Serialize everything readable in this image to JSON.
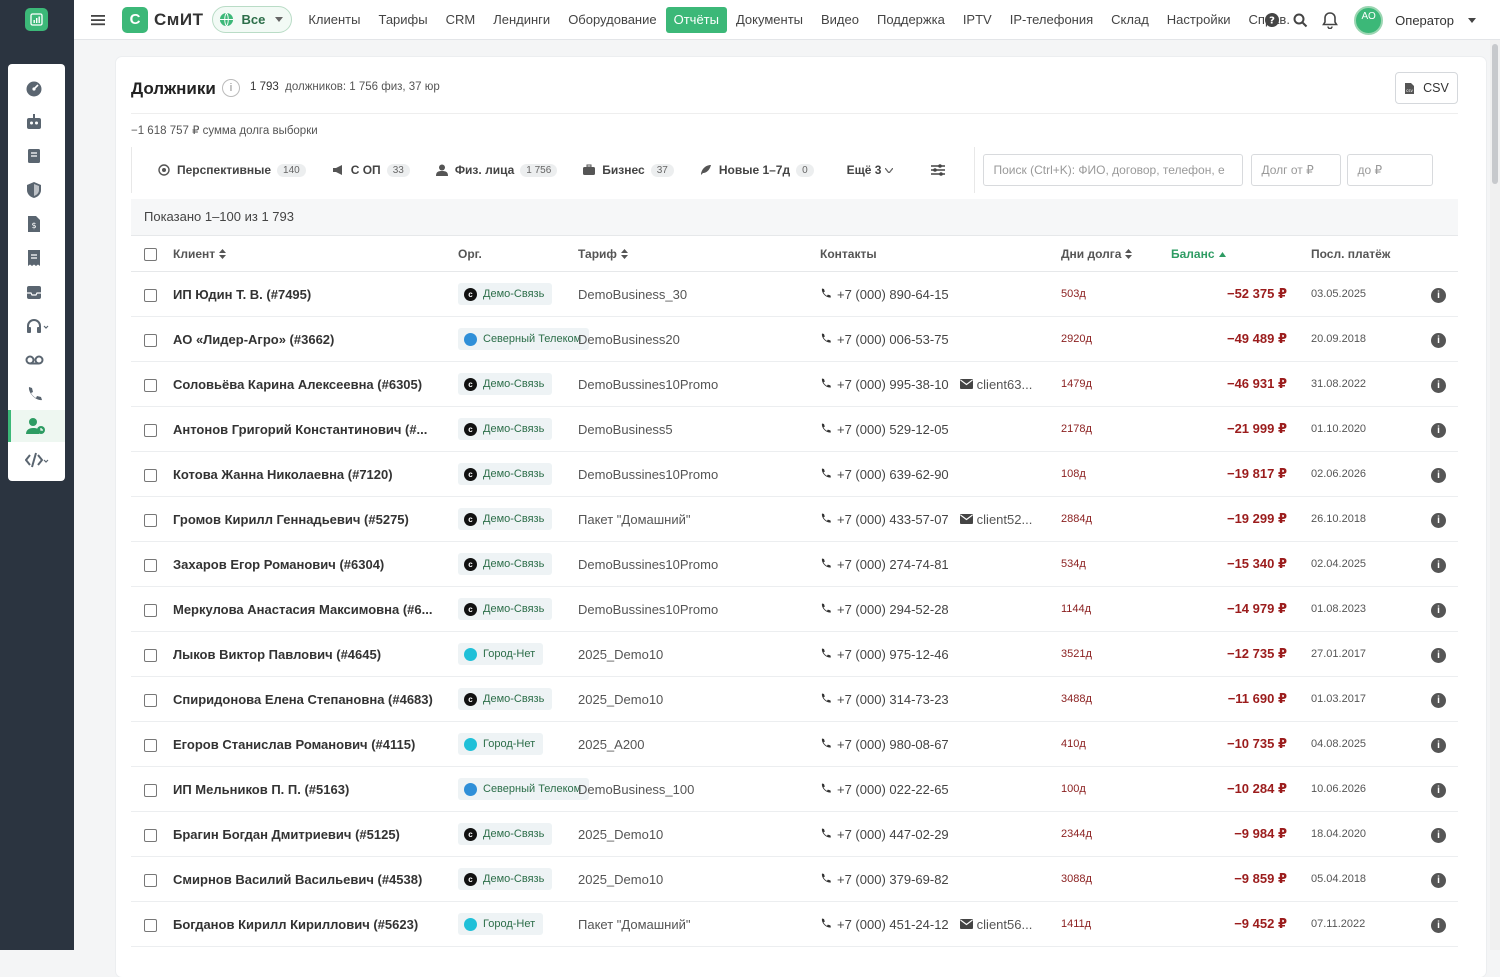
{
  "app": {
    "brand_mark": "С",
    "brand_name": "СмИТ",
    "scope": "Все",
    "operator": "Оператор",
    "avatar_initials": "АО",
    "accent": "#3cb878"
  },
  "nav": [
    "Клиенты",
    "Тарифы",
    "CRM",
    "Лендинги",
    "Оборудование",
    "Отчёты",
    "Документы",
    "Видео",
    "Поддержка",
    "IPTV",
    "IP-телефония",
    "Склад",
    "Настройки",
    "Справ."
  ],
  "nav_active": "Отчёты",
  "rail_icons": [
    "dashboard-icon",
    "robot-icon",
    "book-icon",
    "shield-icon",
    "file-icon",
    "receipt-icon",
    "inbox-icon",
    "headset-icon",
    "voicemail-icon",
    "phone-icon",
    "user-clock-icon",
    "code-icon"
  ],
  "page": {
    "title": "Должники",
    "count": "1 793",
    "count_detail": "должников: 1 756 физ, 37 юр",
    "debt_sum": "−1 618 757 ₽ сумма долга выборки",
    "csv": "CSV",
    "shown": "Показано 1–100 из 1 793"
  },
  "filters": [
    {
      "label": "Перспективные",
      "count": "140",
      "icon": "target-icon"
    },
    {
      "label": "С ОП",
      "count": "33",
      "icon": "megaphone-icon"
    },
    {
      "label": "Физ. лица",
      "count": "1 756",
      "icon": "user-icon"
    },
    {
      "label": "Бизнес",
      "count": "37",
      "icon": "briefcase-icon"
    },
    {
      "label": "Новые 1–7д",
      "count": "0",
      "icon": "feather-icon"
    }
  ],
  "more_filters": "Ещё 3",
  "search": {
    "placeholder": "Поиск (Ctrl+K): ФИО, договор, телефон, e",
    "debt_from": "Долг от ₽",
    "debt_to": "до ₽"
  },
  "columns": {
    "client": "Клиент",
    "org": "Орг.",
    "tariff": "Тариф",
    "contacts": "Контакты",
    "days": "Дни долга",
    "balance": "Баланс",
    "last": "Посл. платёж"
  },
  "orgs": {
    "demo": {
      "name": "Демо-Связь",
      "color": "#111111"
    },
    "north": {
      "name": "Северный Телеком",
      "color": "#2f8fd8"
    },
    "city": {
      "name": "Город-Нет",
      "color": "#20c0d8"
    }
  },
  "rows": [
    {
      "client": "ИП Юдин Т. В. (#7495)",
      "org": "demo",
      "tariff": "DemoBusiness_30",
      "phone": "+7 (000) 890-64-15",
      "email": "",
      "days": "503д",
      "balance": "−52 375 ₽",
      "last": "03.05.2025"
    },
    {
      "client": "АО «Лидер-Агро» (#3662)",
      "org": "north",
      "tariff": "DemoBusiness20",
      "phone": "+7 (000) 006-53-75",
      "email": "",
      "days": "2920д",
      "balance": "−49 489 ₽",
      "last": "20.09.2018"
    },
    {
      "client": "Соловьёва Карина Алексеевна (#6305)",
      "org": "demo",
      "tariff": "DemoBussines10Promo",
      "phone": "+7 (000) 995-38-10",
      "email": "client63...",
      "days": "1479д",
      "balance": "−46 931 ₽",
      "last": "31.08.2022"
    },
    {
      "client": "Антонов Григорий Константинович (#...",
      "org": "demo",
      "tariff": "DemoBusiness5",
      "phone": "+7 (000) 529-12-05",
      "email": "",
      "days": "2178д",
      "balance": "−21 999 ₽",
      "last": "01.10.2020"
    },
    {
      "client": "Котова Жанна Николаевна (#7120)",
      "org": "demo",
      "tariff": "DemoBussines10Promo",
      "phone": "+7 (000) 639-62-90",
      "email": "",
      "days": "108д",
      "balance": "−19 817 ₽",
      "last": "02.06.2026"
    },
    {
      "client": "Громов Кирилл Геннадьевич (#5275)",
      "org": "demo",
      "tariff": "Пакет \"Домашний\"",
      "phone": "+7 (000) 433-57-07",
      "email": "client52...",
      "days": "2884д",
      "balance": "−19 299 ₽",
      "last": "26.10.2018"
    },
    {
      "client": "Захаров Егор Романович (#6304)",
      "org": "demo",
      "tariff": "DemoBussines10Promo",
      "phone": "+7 (000) 274-74-81",
      "email": "",
      "days": "534д",
      "balance": "−15 340 ₽",
      "last": "02.04.2025"
    },
    {
      "client": "Меркулова Анастасия Максимовна (#6...",
      "org": "demo",
      "tariff": "DemoBussines10Promo",
      "phone": "+7 (000) 294-52-28",
      "email": "",
      "days": "1144д",
      "balance": "−14 979 ₽",
      "last": "01.08.2023"
    },
    {
      "client": "Лыков Виктор Павлович (#4645)",
      "org": "city",
      "tariff": "2025_Demo10",
      "phone": "+7 (000) 975-12-46",
      "email": "",
      "days": "3521д",
      "balance": "−12 735 ₽",
      "last": "27.01.2017"
    },
    {
      "client": "Спиридонова Елена Степановна (#4683)",
      "org": "demo",
      "tariff": "2025_Demo10",
      "phone": "+7 (000) 314-73-23",
      "email": "",
      "days": "3488д",
      "balance": "−11 690 ₽",
      "last": "01.03.2017"
    },
    {
      "client": "Егоров Станислав Романович (#4115)",
      "org": "city",
      "tariff": "2025_A200",
      "phone": "+7 (000) 980-08-67",
      "email": "",
      "days": "410д",
      "balance": "−10 735 ₽",
      "last": "04.08.2025"
    },
    {
      "client": "ИП Мельников П. П. (#5163)",
      "org": "north",
      "tariff": "DemoBusiness_100",
      "phone": "+7 (000) 022-22-65",
      "email": "",
      "days": "100д",
      "balance": "−10 284 ₽",
      "last": "10.06.2026"
    },
    {
      "client": "Брагин Богдан Дмитриевич (#5125)",
      "org": "demo",
      "tariff": "2025_Demo10",
      "phone": "+7 (000) 447-02-29",
      "email": "",
      "days": "2344д",
      "balance": "−9 984 ₽",
      "last": "18.04.2020"
    },
    {
      "client": "Смирнов Василий Васильевич (#4538)",
      "org": "demo",
      "tariff": "2025_Demo10",
      "phone": "+7 (000) 379-69-82",
      "email": "",
      "days": "3088д",
      "balance": "−9 859 ₽",
      "last": "05.04.2018"
    },
    {
      "client": "Богданов Кирилл Кириллович (#5623)",
      "org": "city",
      "tariff": "Пакет \"Домашний\"",
      "phone": "+7 (000) 451-24-12",
      "email": "client56...",
      "days": "1411д",
      "balance": "−9 452 ₽",
      "last": "07.11.2022"
    }
  ]
}
